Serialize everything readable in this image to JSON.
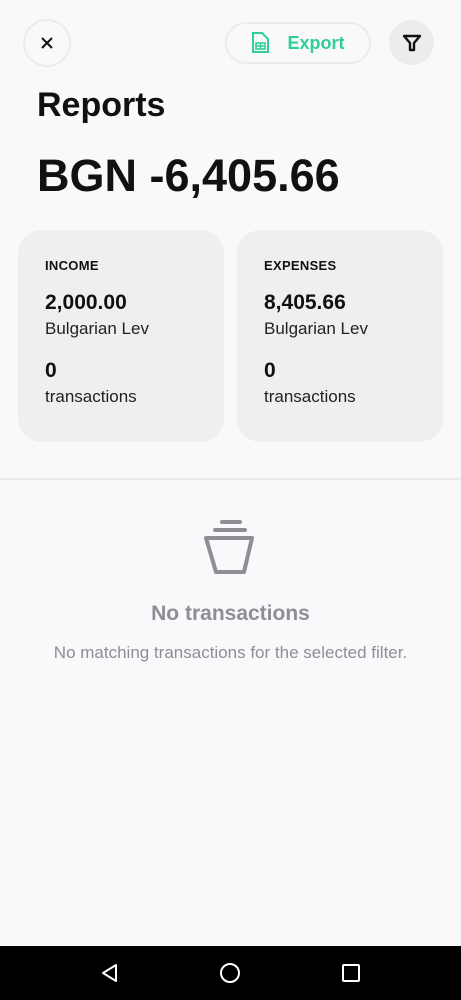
{
  "header": {
    "export_label": "Export",
    "title": "Reports",
    "total": "BGN -6,405.66"
  },
  "income": {
    "label": "INCOME",
    "amount": "2,000.00",
    "currency": "Bulgarian Lev",
    "count": "0",
    "count_label": "transactions"
  },
  "expenses": {
    "label": "EXPENSES",
    "amount": "8,405.66",
    "currency": "Bulgarian Lev",
    "count": "0",
    "count_label": "transactions"
  },
  "empty": {
    "title": "No transactions",
    "subtitle": "No matching transactions for the selected filter."
  },
  "colors": {
    "accent": "#2fcf95"
  }
}
